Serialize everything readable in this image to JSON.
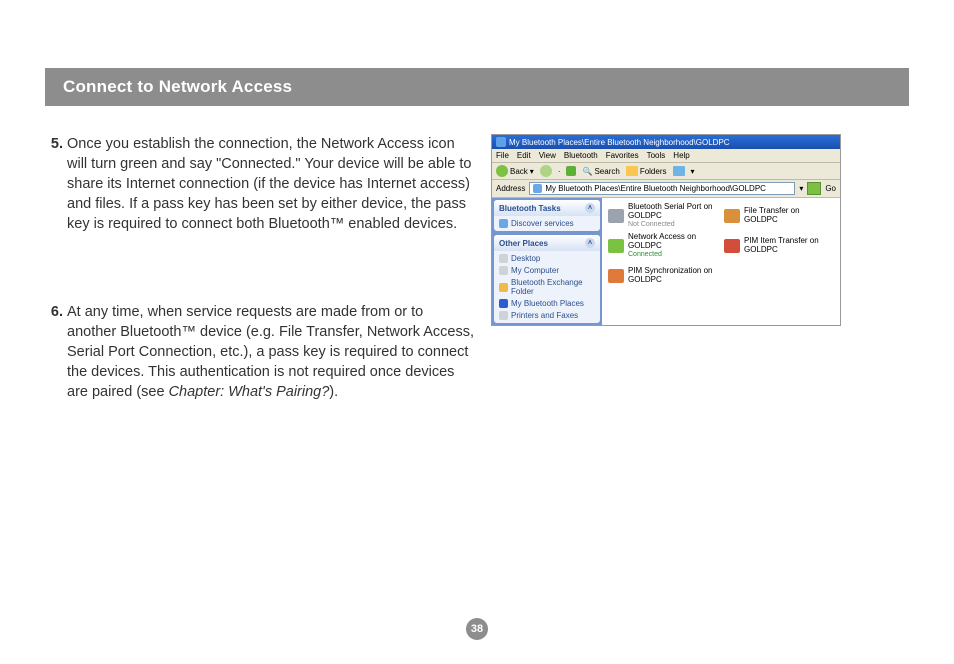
{
  "header": {
    "title": "Connect to Network Access"
  },
  "steps": [
    {
      "num": "5.",
      "text": "Once you establish the connection, the Network Access icon will turn green and say \"Connected.\"  Your device will be able to share its Internet connection (if the device has Internet access)\nand files. If a pass key has been set by either device, the pass key is required to connect both Bluetooth™ enabled devices."
    },
    {
      "num": "6.",
      "text_pre": "At any time, when service requests are made from or to another Bluetooth™ device (e.g. File Transfer, Network Access, Serial Port Connection, etc.), a pass key is required to connect the devices. This authentication is not required once devices are paired (see ",
      "text_italic": "Chapter: What's Pairing?",
      "text_post": ")."
    }
  ],
  "screenshot": {
    "title": "My Bluetooth Places\\Entire Bluetooth Neighborhood\\GOLDPC",
    "menus": [
      "File",
      "Edit",
      "View",
      "Bluetooth",
      "Favorites",
      "Tools",
      "Help"
    ],
    "toolbar": {
      "back": "Back",
      "search": "Search",
      "folders": "Folders"
    },
    "address": {
      "label": "Address",
      "value": "My Bluetooth Places\\Entire Bluetooth Neighborhood\\GOLDPC",
      "go": "Go"
    },
    "panels": {
      "tasks": {
        "title": "Bluetooth Tasks",
        "items": [
          "Discover services"
        ]
      },
      "other": {
        "title": "Other Places",
        "items": [
          "Desktop",
          "My Computer",
          "Bluetooth Exchange Folder",
          "My Bluetooth Places",
          "Printers and Faxes"
        ]
      }
    },
    "files": [
      {
        "name": "Bluetooth Serial Port on GOLDPC",
        "sub": "Not Connected",
        "cls": "serial"
      },
      {
        "name": "File Transfer on GOLDPC",
        "sub": "",
        "cls": "ft"
      },
      {
        "name": "Network Access on GOLDPC",
        "sub": "Connected",
        "subcls": "green",
        "cls": "net"
      },
      {
        "name": "PIM Item Transfer on GOLDPC",
        "sub": "",
        "cls": "pim"
      },
      {
        "name": "PIM Synchronization on GOLDPC",
        "sub": "",
        "cls": "sync"
      }
    ]
  },
  "page_number": "38"
}
